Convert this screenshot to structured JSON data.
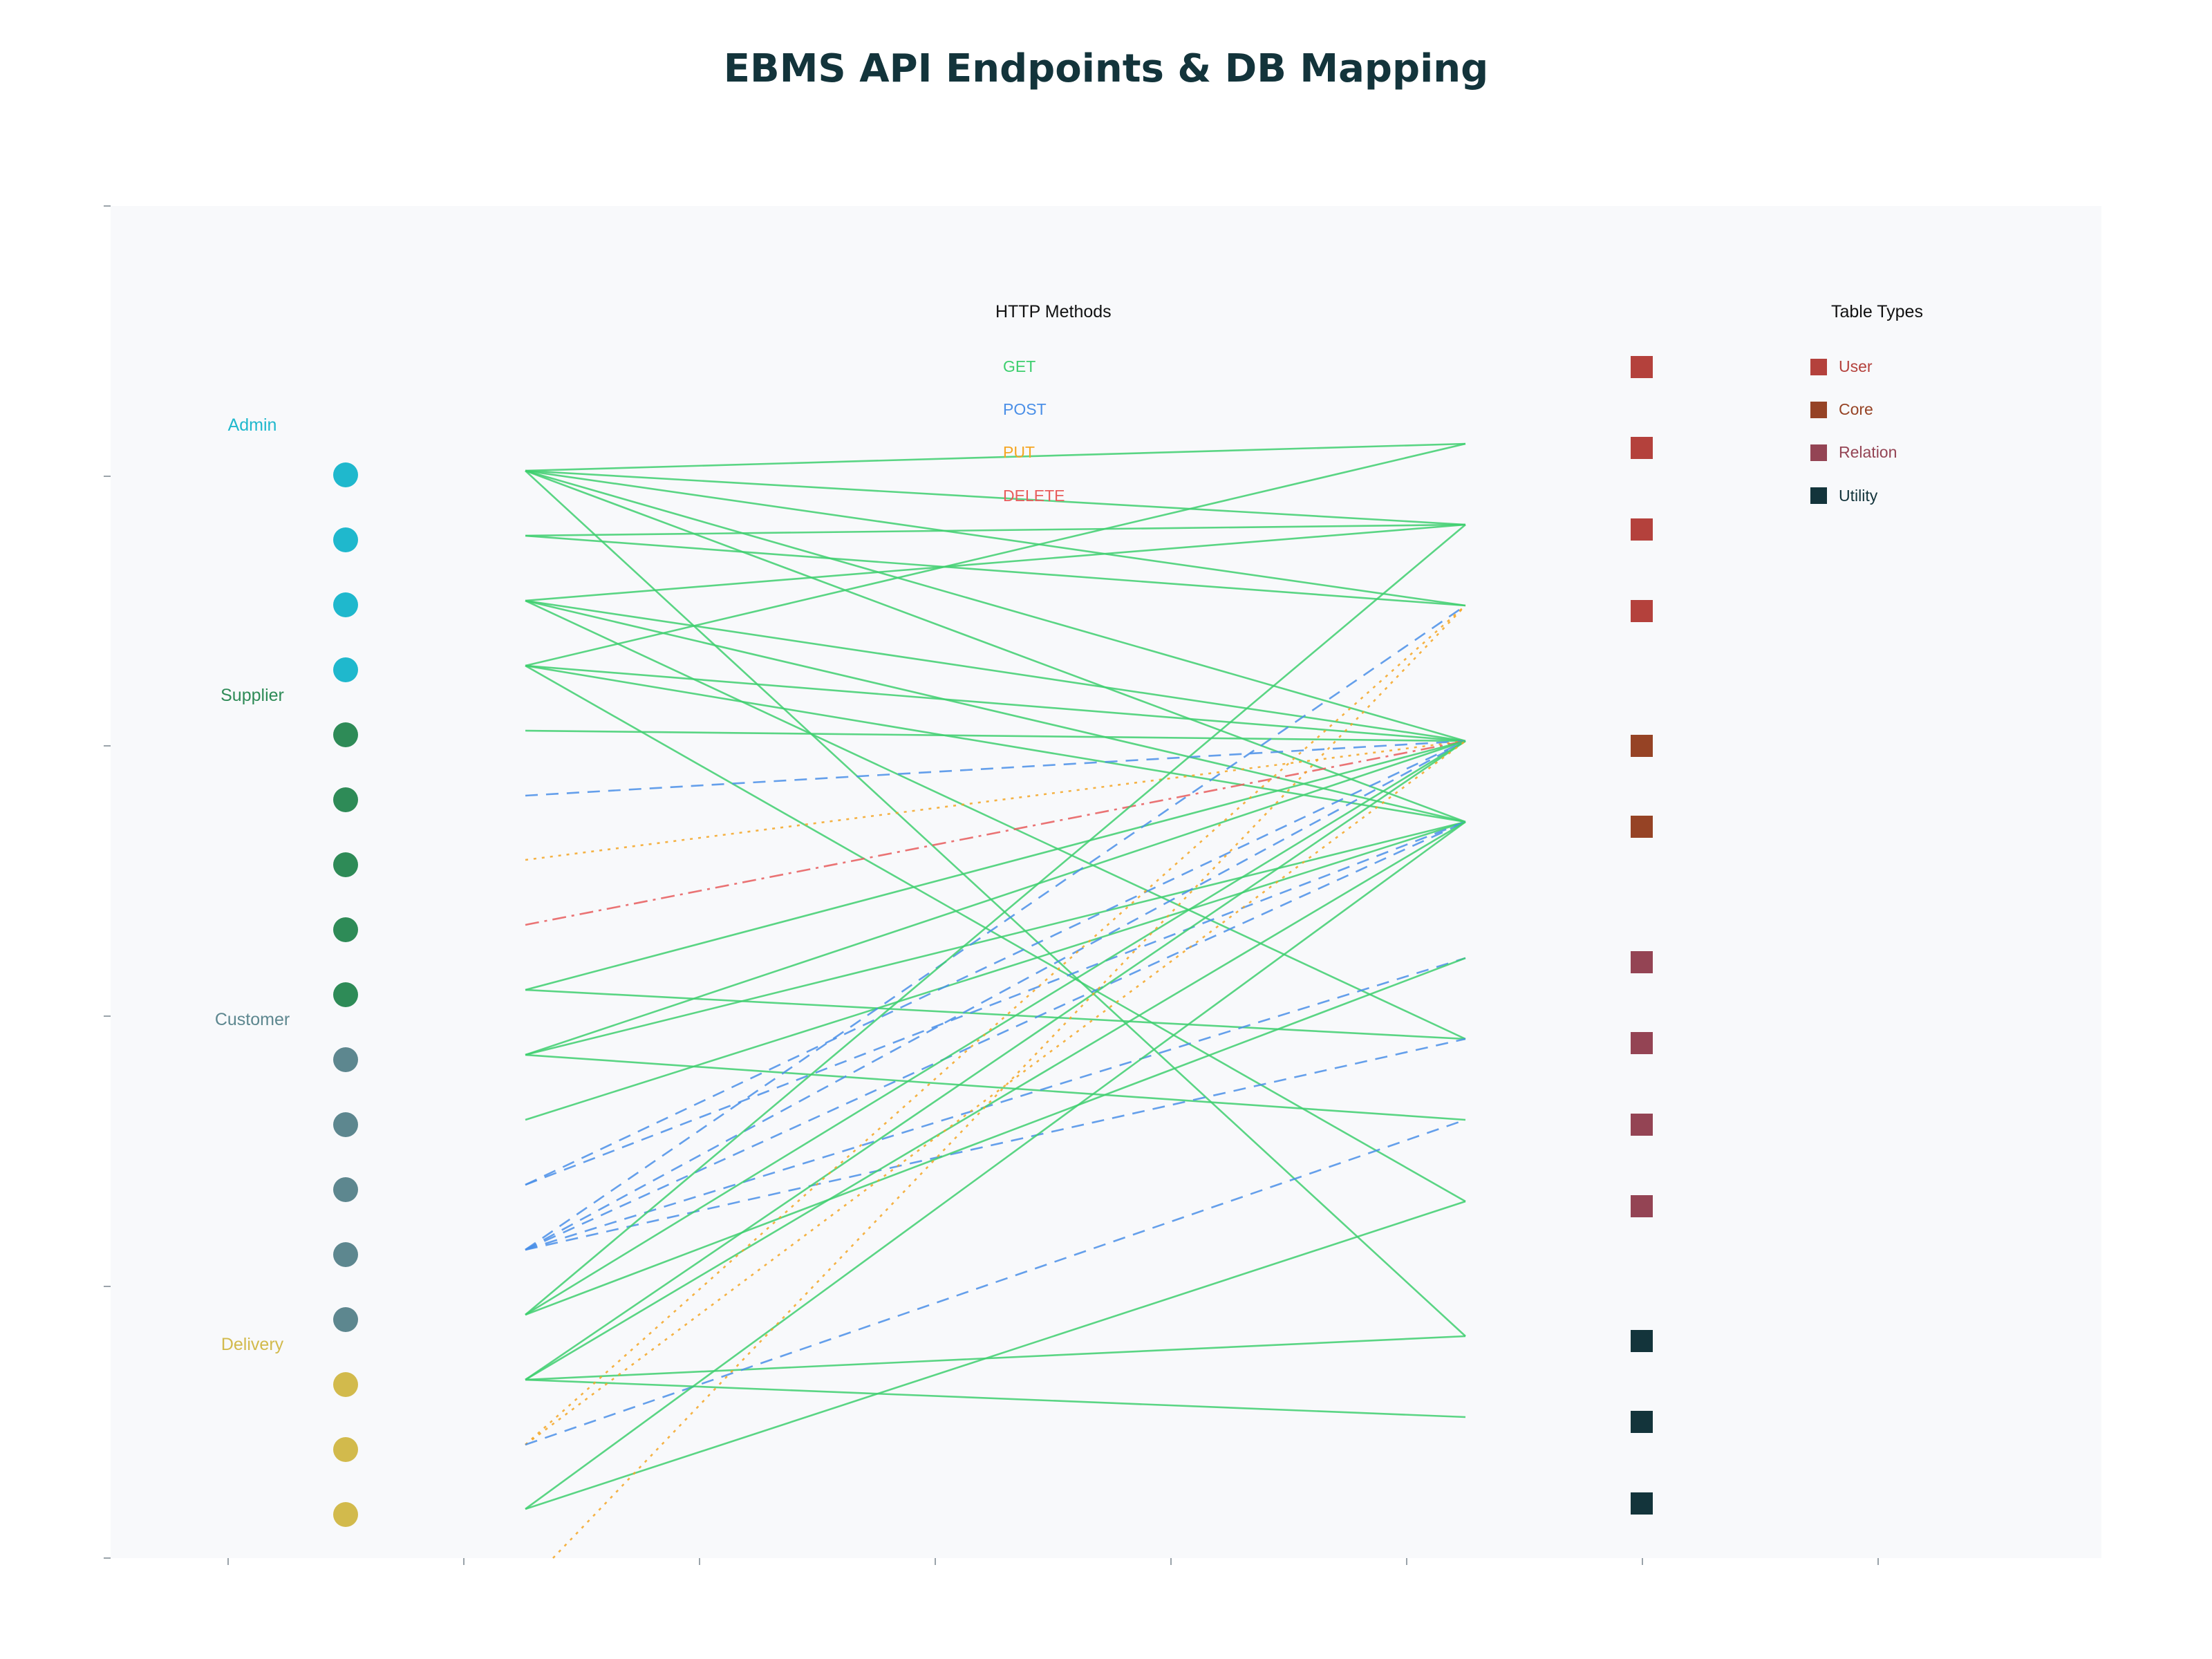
{
  "title": "EBMS API Endpoints & DB Mapping",
  "colors": {
    "background": "#ffffff",
    "plot_background": "#f8f9fb",
    "title": "#13343b",
    "roles": {
      "Admin": "#1fb8cd",
      "Supplier": "#2e8b57",
      "Customer": "#5d878f",
      "Delivery": "#d2ba4c"
    },
    "methods": {
      "GET": "#3ecf6e",
      "POST": "#4a8fe7",
      "PUT": "#f5a623",
      "DELETE": "#e85c5c"
    },
    "table_types": {
      "User": "#b4413c",
      "Core": "#944454",
      "Relation": "#964325",
      "Utility": "#13343b"
    }
  },
  "role_groups": [
    {
      "name": "Admin",
      "color": "#1fb8cd",
      "endpoints": [
        0,
        1,
        2,
        3
      ]
    },
    {
      "name": "Supplier",
      "color": "#2e8b57",
      "endpoints": [
        4,
        5,
        6,
        7,
        8
      ]
    },
    {
      "name": "Customer",
      "color": "#5d878f",
      "endpoints": [
        9,
        10,
        11,
        12,
        13
      ]
    },
    {
      "name": "Delivery",
      "color": "#d2ba4c",
      "endpoints": [
        14,
        15,
        16
      ]
    }
  ],
  "methods_legend": {
    "title": "HTTP Methods",
    "items": [
      {
        "label": "GET",
        "color": "#3ecf6e",
        "dash": "solid"
      },
      {
        "label": "POST",
        "color": "#4a8fe7",
        "dash": "dash"
      },
      {
        "label": "PUT",
        "color": "#f5a623",
        "dash": "dot"
      },
      {
        "label": "DELETE",
        "color": "#e85c5c",
        "dash": "dashdot"
      }
    ]
  },
  "table_types_legend": {
    "title": "Table Types",
    "items": [
      {
        "label": "User",
        "color": "#b4413c"
      },
      {
        "label": "Core",
        "color": "#944454"
      },
      {
        "label": "Relation",
        "color": "#964325"
      },
      {
        "label": "Utility",
        "color": "#13343b"
      }
    ]
  },
  "endpoints": [
    {
      "role": "Admin",
      "label": ""
    },
    {
      "role": "Admin",
      "label": ""
    },
    {
      "role": "Admin",
      "label": ""
    },
    {
      "role": "Admin",
      "label": ""
    },
    {
      "role": "Supplier",
      "label": ""
    },
    {
      "role": "Supplier",
      "label": ""
    },
    {
      "role": "Supplier",
      "label": ""
    },
    {
      "role": "Supplier",
      "label": ""
    },
    {
      "role": "Supplier",
      "label": ""
    },
    {
      "role": "Customer",
      "label": ""
    },
    {
      "role": "Customer",
      "label": ""
    },
    {
      "role": "Customer",
      "label": ""
    },
    {
      "role": "Customer",
      "label": ""
    },
    {
      "role": "Customer",
      "label": ""
    },
    {
      "role": "Delivery",
      "label": ""
    },
    {
      "role": "Delivery",
      "label": ""
    },
    {
      "role": "Delivery",
      "label": ""
    }
  ],
  "tables": [
    {
      "type": "User",
      "color": "#b4413c",
      "label": ""
    },
    {
      "type": "User",
      "color": "#b4413c",
      "label": ""
    },
    {
      "type": "User",
      "color": "#b4413c",
      "label": ""
    },
    {
      "type": "User",
      "color": "#b4413c",
      "label": ""
    },
    {
      "type": "Relation",
      "color": "#964325",
      "label": ""
    },
    {
      "type": "Relation",
      "color": "#964325",
      "label": ""
    },
    {
      "type": "Core",
      "color": "#944454",
      "label": ""
    },
    {
      "type": "Core",
      "color": "#944454",
      "label": ""
    },
    {
      "type": "Core",
      "color": "#944454",
      "label": ""
    },
    {
      "type": "Core",
      "color": "#944454",
      "label": ""
    },
    {
      "type": "Utility",
      "color": "#13343b",
      "label": ""
    },
    {
      "type": "Utility",
      "color": "#13343b",
      "label": ""
    },
    {
      "type": "Utility",
      "color": "#13343b",
      "label": ""
    }
  ],
  "links": [
    {
      "from": 0,
      "to": 0,
      "method": "GET"
    },
    {
      "from": 0,
      "to": 1,
      "method": "GET"
    },
    {
      "from": 0,
      "to": 2,
      "method": "GET"
    },
    {
      "from": 0,
      "to": 4,
      "method": "GET"
    },
    {
      "from": 0,
      "to": 5,
      "method": "GET"
    },
    {
      "from": 0,
      "to": 10,
      "method": "GET"
    },
    {
      "from": 1,
      "to": 1,
      "method": "GET"
    },
    {
      "from": 1,
      "to": 2,
      "method": "GET"
    },
    {
      "from": 2,
      "to": 1,
      "method": "GET"
    },
    {
      "from": 2,
      "to": 4,
      "method": "GET"
    },
    {
      "from": 2,
      "to": 5,
      "method": "GET"
    },
    {
      "from": 2,
      "to": 7,
      "method": "GET"
    },
    {
      "from": 3,
      "to": 0,
      "method": "GET"
    },
    {
      "from": 3,
      "to": 4,
      "method": "GET"
    },
    {
      "from": 3,
      "to": 5,
      "method": "GET"
    },
    {
      "from": 3,
      "to": 9,
      "method": "GET"
    },
    {
      "from": 4,
      "to": 4,
      "method": "GET"
    },
    {
      "from": 5,
      "to": 4,
      "method": "POST"
    },
    {
      "from": 6,
      "to": 4,
      "method": "PUT"
    },
    {
      "from": 7,
      "to": 4,
      "method": "DELETE"
    },
    {
      "from": 8,
      "to": 4,
      "method": "GET"
    },
    {
      "from": 8,
      "to": 7,
      "method": "GET"
    },
    {
      "from": 9,
      "to": 4,
      "method": "GET"
    },
    {
      "from": 9,
      "to": 5,
      "method": "GET"
    },
    {
      "from": 9,
      "to": 8,
      "method": "GET"
    },
    {
      "from": 10,
      "to": 5,
      "method": "GET"
    },
    {
      "from": 11,
      "to": 4,
      "method": "POST"
    },
    {
      "from": 11,
      "to": 5,
      "method": "POST"
    },
    {
      "from": 12,
      "to": 2,
      "method": "POST"
    },
    {
      "from": 12,
      "to": 4,
      "method": "POST"
    },
    {
      "from": 12,
      "to": 5,
      "method": "POST"
    },
    {
      "from": 12,
      "to": 6,
      "method": "POST"
    },
    {
      "from": 12,
      "to": 7,
      "method": "POST"
    },
    {
      "from": 13,
      "to": 1,
      "method": "GET"
    },
    {
      "from": 13,
      "to": 4,
      "method": "GET"
    },
    {
      "from": 13,
      "to": 6,
      "method": "GET"
    },
    {
      "from": 14,
      "to": 4,
      "method": "GET"
    },
    {
      "from": 14,
      "to": 5,
      "method": "GET"
    },
    {
      "from": 14,
      "to": 10,
      "method": "GET"
    },
    {
      "from": 14,
      "to": 11,
      "method": "GET"
    },
    {
      "from": 15,
      "to": 2,
      "method": "PUT"
    },
    {
      "from": 15,
      "to": 4,
      "method": "PUT"
    },
    {
      "from": 15,
      "to": 8,
      "method": "POST"
    },
    {
      "from": 16,
      "to": 9,
      "method": "GET"
    },
    {
      "from": 16,
      "to": 5,
      "method": "GET"
    }
  ],
  "edge_links": [
    {
      "to": 2,
      "method": "PUT"
    }
  ]
}
